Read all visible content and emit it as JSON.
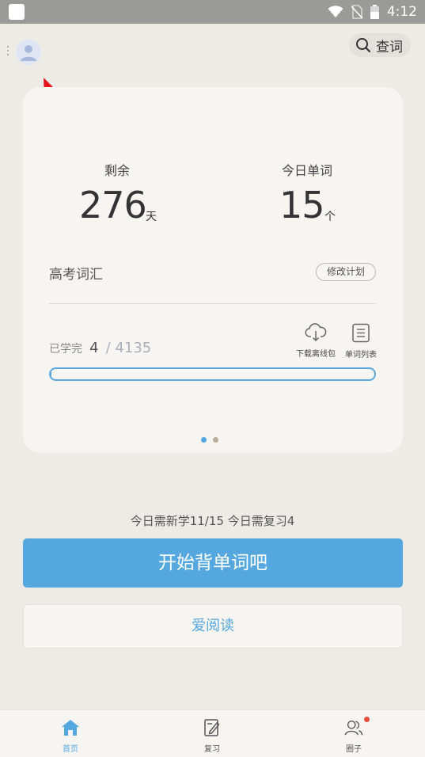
{
  "status_bar": {
    "time": "4:12",
    "icons": [
      "wifi-icon",
      "no-sim-icon",
      "battery-icon"
    ]
  },
  "header": {
    "avatar_icon": "user-avatar-icon",
    "menu_icon": "more-vertical-icon",
    "search_icon": "search-icon",
    "search_label": "查词"
  },
  "card": {
    "remaining": {
      "label": "剩余",
      "value": "276",
      "unit": "天"
    },
    "today_words": {
      "label": "今日单词",
      "value": "15",
      "unit": "个"
    },
    "vocab_name": "高考词汇",
    "edit_plan_label": "修改计划",
    "learned": {
      "label": "已学完",
      "count": "4",
      "total_text": "/ 4135",
      "progress_fraction": 0.001
    },
    "tools": [
      {
        "label": "下载离线包",
        "icon": "cloud-download-icon"
      },
      {
        "label": "单词列表",
        "icon": "word-list-icon"
      }
    ],
    "page_indicator": {
      "count": 2,
      "active": 0
    }
  },
  "summary_text": "今日需新学11/15  今日需复习4",
  "start_button_label": "开始背单词吧",
  "read_button_label": "爱阅读",
  "bottom_nav": [
    {
      "label": "首页",
      "icon": "home-icon",
      "active": true
    },
    {
      "label": "复习",
      "icon": "review-edit-icon",
      "active": false
    },
    {
      "label": "圈子",
      "icon": "community-icon",
      "active": false,
      "badge": true
    }
  ],
  "colors": {
    "accent": "#55a8df",
    "background": "#ecebe6",
    "card": "#f6f5f1",
    "annotation_arrow": "#e8141b",
    "badge": "#e74c3c"
  }
}
